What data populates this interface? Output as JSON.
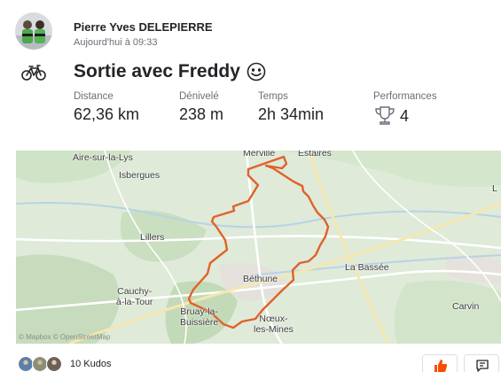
{
  "athlete": {
    "name": "Pierre Yves DELEPIERRE",
    "timestamp": "Aujourd'hui à 09:33",
    "avatar_icon": "athlete-avatar"
  },
  "activity": {
    "sport_icon": "bike-icon",
    "title": "Sortie avec Freddy",
    "emoji": "smiling-face-emoji"
  },
  "stats": {
    "distance": {
      "label": "Distance",
      "value": "62,36 km"
    },
    "elevation": {
      "label": "Dénivelé",
      "value": "238 m"
    },
    "time": {
      "label": "Temps",
      "value": "2h 34min"
    },
    "achievements": {
      "label": "Performances",
      "value": "4",
      "icon": "trophy-icon"
    }
  },
  "map": {
    "route_color": "#e0622a",
    "places": [
      "Merville",
      "Estaires",
      "Aire-sur-la-Lys",
      "Isbergues",
      "Lillers",
      "Béthune",
      "La Bassée",
      "Cauchy-\nà-la-Tour",
      "Bruay-la-\nBuissière",
      "Nœux-\nles-Mines",
      "Carvin",
      "L"
    ],
    "attribution": "© Mapbox © OpenStreetMap"
  },
  "footer": {
    "kudos": "10 Kudos",
    "kudos_icon": "thumbs-up-icon",
    "comment_icon": "comment-icon",
    "brand_color": "#fc4c02"
  }
}
